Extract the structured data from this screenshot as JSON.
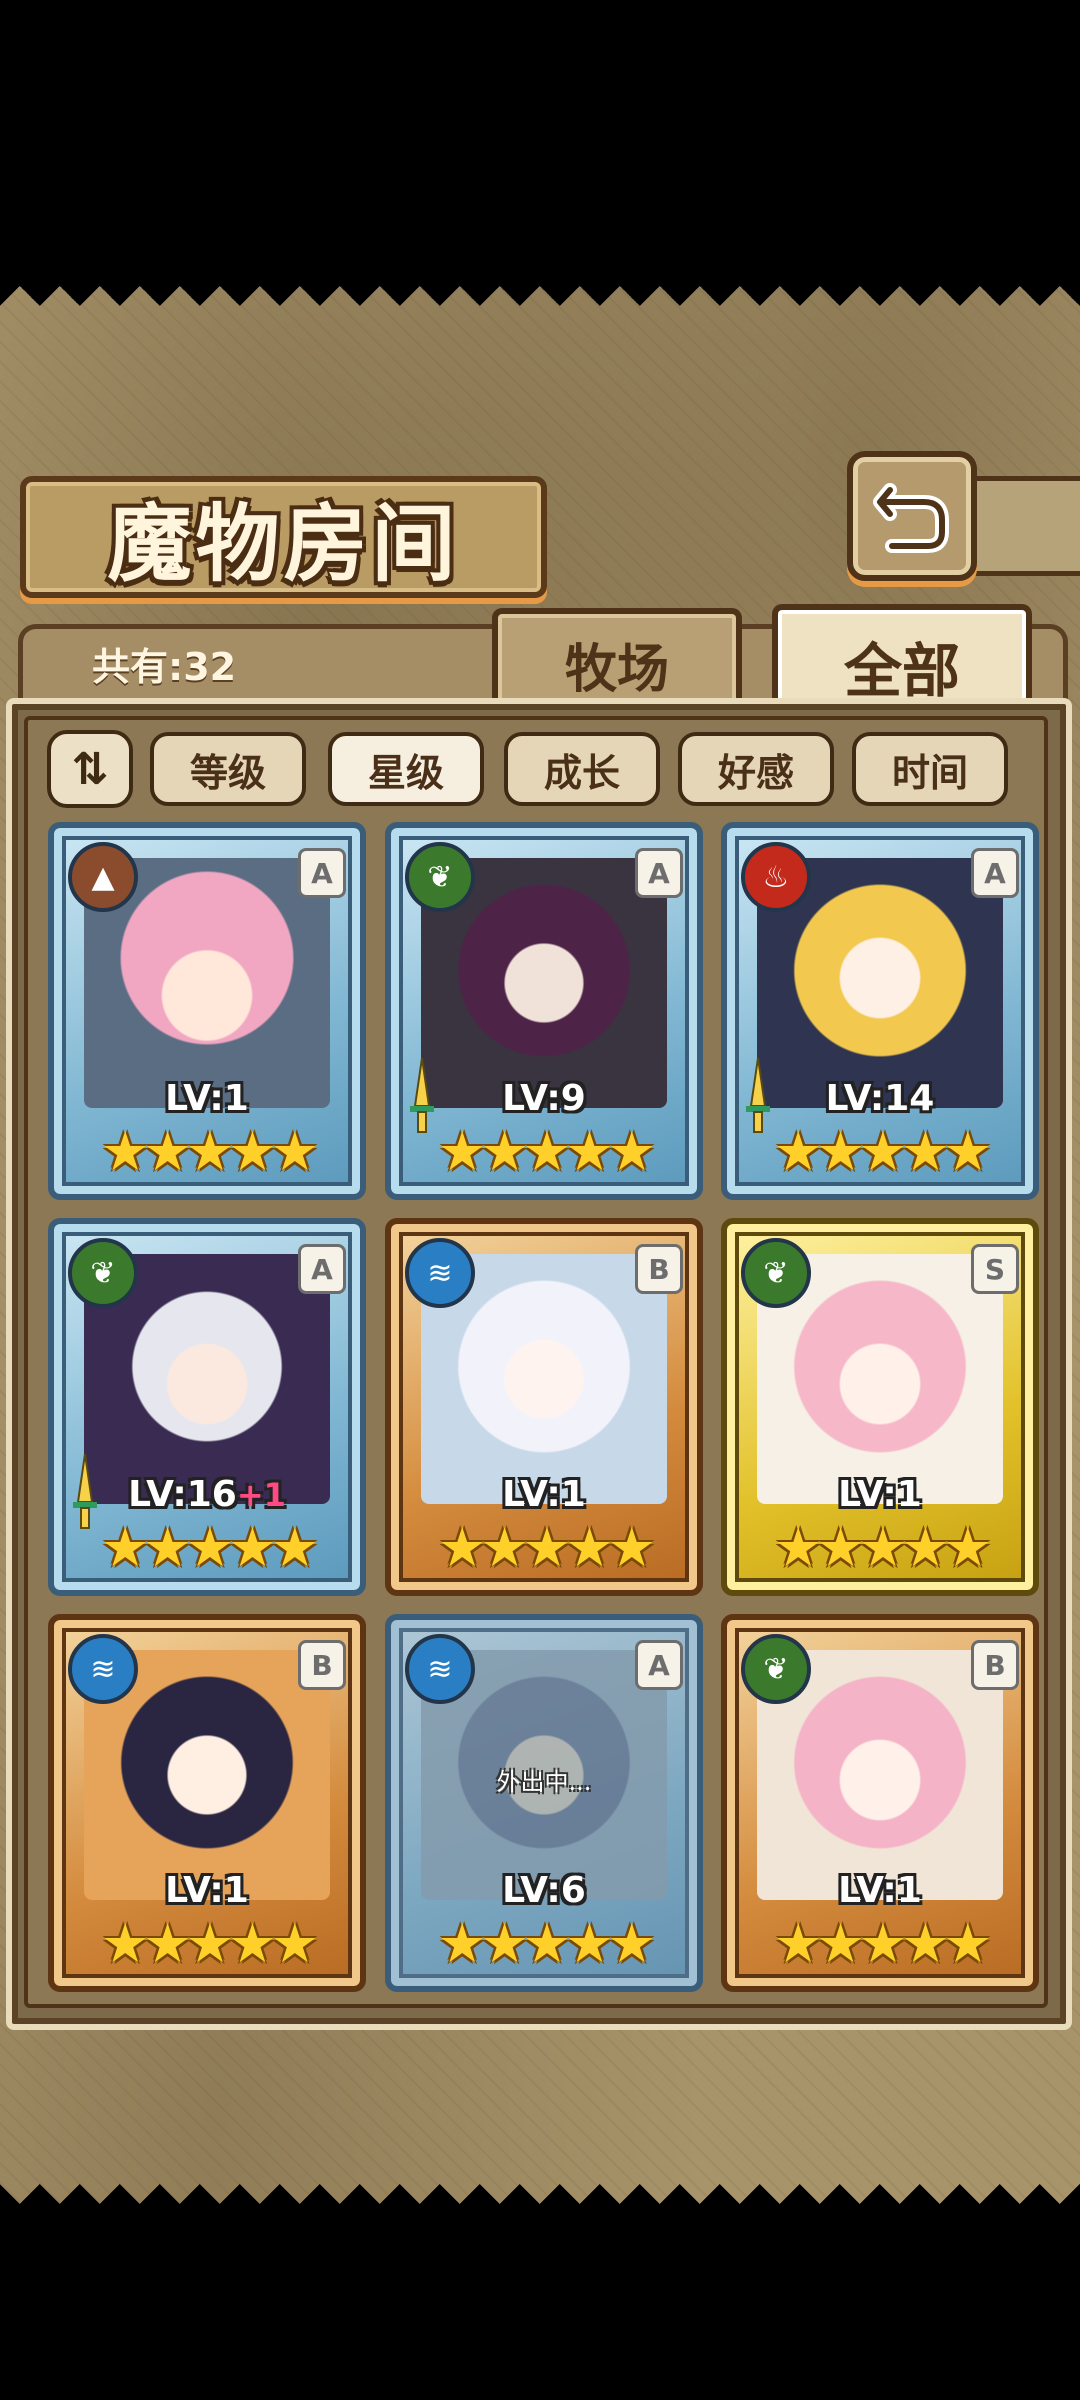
{
  "header": {
    "title": "魔物房间",
    "back_icon": "return-arrow-icon"
  },
  "summary": {
    "count_label": "共有:32"
  },
  "tabs": [
    {
      "label": "牧场",
      "selected": false
    },
    {
      "label": "全部",
      "selected": true
    }
  ],
  "sort": {
    "toggle_icon": "ascending-descending-icon",
    "options": [
      {
        "label": "等级",
        "active": false
      },
      {
        "label": "星级",
        "active": true
      },
      {
        "label": "成长",
        "active": false
      },
      {
        "label": "好感",
        "active": false
      },
      {
        "label": "时间",
        "active": false
      }
    ]
  },
  "monsters": [
    {
      "element": "earth",
      "rank": "A",
      "level": "LV:1",
      "bonus": "",
      "stars": 5,
      "frame": "blue",
      "status": "",
      "weapon": false
    },
    {
      "element": "wood",
      "rank": "A",
      "level": "LV:9",
      "bonus": "",
      "stars": 5,
      "frame": "blue",
      "status": "",
      "weapon": true
    },
    {
      "element": "fire",
      "rank": "A",
      "level": "LV:14",
      "bonus": "",
      "stars": 5,
      "frame": "blue",
      "status": "",
      "weapon": true
    },
    {
      "element": "wood",
      "rank": "A",
      "level": "LV:16",
      "bonus": "+1",
      "stars": 5,
      "frame": "blue",
      "status": "",
      "weapon": true
    },
    {
      "element": "water",
      "rank": "B",
      "level": "LV:1",
      "bonus": "",
      "stars": 5,
      "frame": "orange",
      "status": "",
      "weapon": false
    },
    {
      "element": "wood",
      "rank": "S",
      "level": "LV:1",
      "bonus": "",
      "stars": 5,
      "frame": "gold",
      "status": "",
      "weapon": false
    },
    {
      "element": "water",
      "rank": "B",
      "level": "LV:1",
      "bonus": "",
      "stars": 5,
      "frame": "orange",
      "status": "",
      "weapon": false
    },
    {
      "element": "water",
      "rank": "A",
      "level": "LV:6",
      "bonus": "",
      "stars": 5,
      "frame": "blue",
      "status": "外出中...",
      "weapon": false
    },
    {
      "element": "wood",
      "rank": "B",
      "level": "LV:1",
      "bonus": "",
      "stars": 5,
      "frame": "orange",
      "status": "",
      "weapon": false
    }
  ],
  "colors": {
    "panel": "#a8946a",
    "frame_dark": "#4e3318",
    "star": "#ffd02a",
    "bonus": "#ff4a86"
  }
}
